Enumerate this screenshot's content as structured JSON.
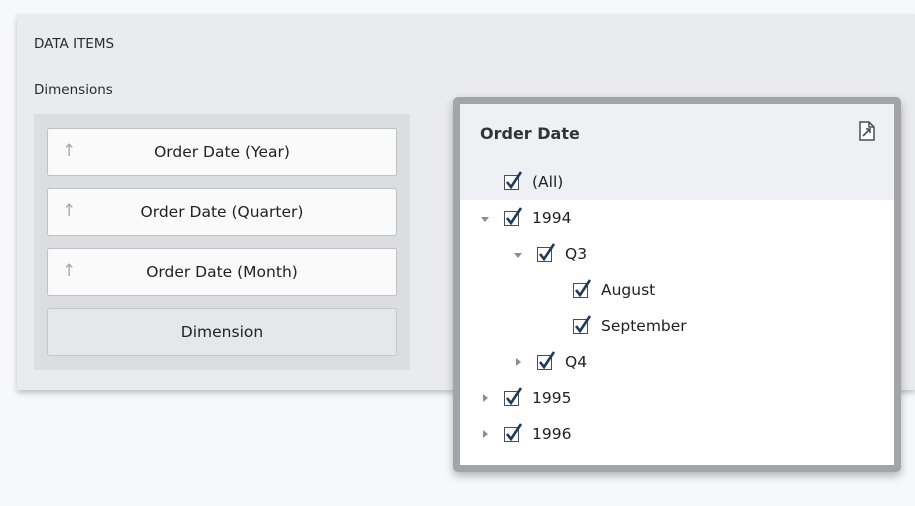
{
  "panel": {
    "section_title": "DATA ITEMS",
    "dimensions_label": "Dimensions",
    "dimensions": [
      {
        "label": "Order Date (Year)",
        "icon": "sort-ascending-arrow-icon"
      },
      {
        "label": "Order Date (Quarter)",
        "icon": "sort-ascending-arrow-icon"
      },
      {
        "label": "Order Date (Month)",
        "icon": "sort-ascending-arrow-icon"
      }
    ],
    "placeholder_label": "Dimension"
  },
  "popup": {
    "title": "Order Date",
    "header_icon": "export-icon",
    "tree": [
      {
        "label": "(All)",
        "checked": true,
        "toggle": "none"
      },
      {
        "label": "1994",
        "checked": true,
        "toggle": "expanded"
      },
      {
        "label": "Q3",
        "checked": true,
        "toggle": "expanded"
      },
      {
        "label": "August",
        "checked": true,
        "toggle": "none"
      },
      {
        "label": "September",
        "checked": true,
        "toggle": "none"
      },
      {
        "label": "Q4",
        "checked": true,
        "toggle": "collapsed"
      },
      {
        "label": "1995",
        "checked": true,
        "toggle": "collapsed"
      },
      {
        "label": "1996",
        "checked": true,
        "toggle": "collapsed"
      }
    ]
  },
  "colors": {
    "panel_bg": "#eaebee",
    "dimension_area_bg": "#dcdde1",
    "popup_border": "#a2a4a8",
    "header_bg": "#eef0f3",
    "checkmark": "#1f3a5a"
  }
}
